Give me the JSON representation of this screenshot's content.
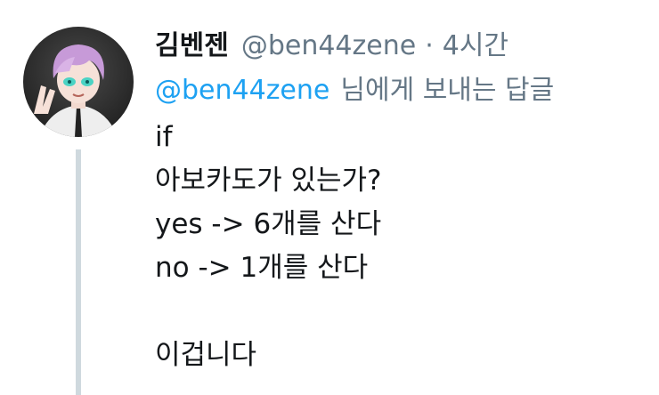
{
  "author": {
    "display_name": "김벤젠",
    "handle": "@ben44zene",
    "separator": "·",
    "timestamp": "4시간"
  },
  "reply_context": {
    "mention": "@ben44zene",
    "suffix": "님에게 보내는 답글"
  },
  "body_lines": [
    "if",
    "아보카도가 있는가?",
    "yes -> 6개를 산다",
    "no -> 1개를 산다",
    "",
    "이겁니다"
  ],
  "colors": {
    "link": "#1da1f2",
    "muted": "#657786",
    "text": "#14171a",
    "thread_line": "#cfd9de"
  },
  "icons": {
    "avatar": "anime-character-avatar"
  }
}
